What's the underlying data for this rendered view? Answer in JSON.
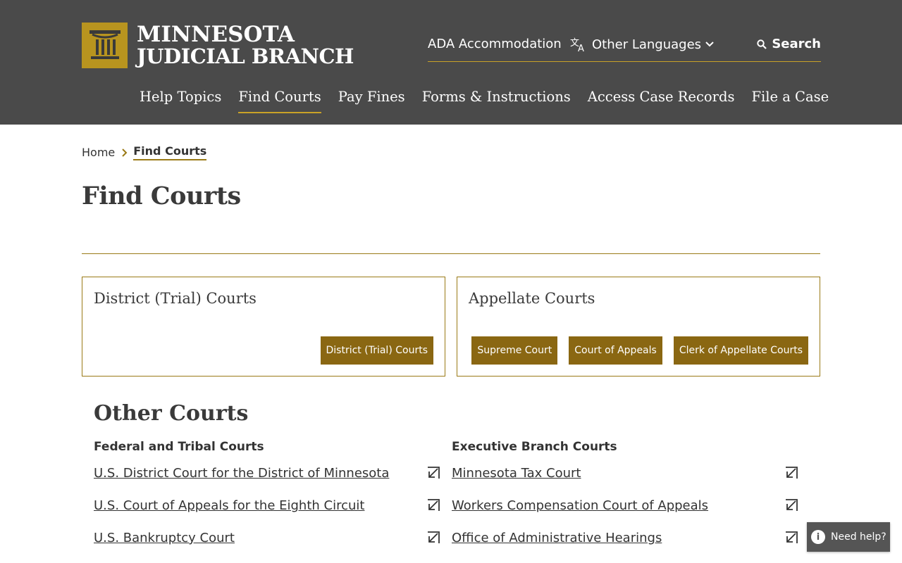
{
  "header": {
    "logo_line1": "MINNESOTA",
    "logo_line2": "JUDICIAL BRANCH",
    "ada_label": "ADA Accommodation",
    "languages_label": "Other Languages",
    "search_label": "Search",
    "nav": [
      {
        "label": "Help Topics"
      },
      {
        "label": "Find Courts",
        "active": true
      },
      {
        "label": "Pay Fines"
      },
      {
        "label": "Forms & Instructions"
      },
      {
        "label": "Access Case Records"
      },
      {
        "label": "File a Case"
      }
    ]
  },
  "breadcrumb": {
    "home": "Home",
    "current": "Find Courts"
  },
  "page_title": "Find Courts",
  "cards": {
    "district": {
      "title": "District (Trial) Courts",
      "buttons": [
        "District (Trial) Courts"
      ]
    },
    "appellate": {
      "title": "Appellate Courts",
      "buttons": [
        "Supreme Court",
        "Court of Appeals",
        "Clerk of Appellate Courts"
      ]
    }
  },
  "other_courts": {
    "title": "Other Courts",
    "federal": {
      "heading": "Federal and Tribal Courts",
      "links": [
        "U.S. District Court for the District of Minnesota",
        "U.S. Court of Appeals for the Eighth Circuit",
        "U.S. Bankruptcy Court"
      ]
    },
    "executive": {
      "heading": "Executive Branch Courts",
      "links": [
        "Minnesota Tax Court",
        "Workers Compensation Court of Appeals",
        "Office of Administrative Hearings"
      ]
    }
  },
  "help_button": "Need help?",
  "colors": {
    "header_bg": "#4a4a4a",
    "gold": "#c9a227",
    "button_bg": "#8a6712"
  }
}
